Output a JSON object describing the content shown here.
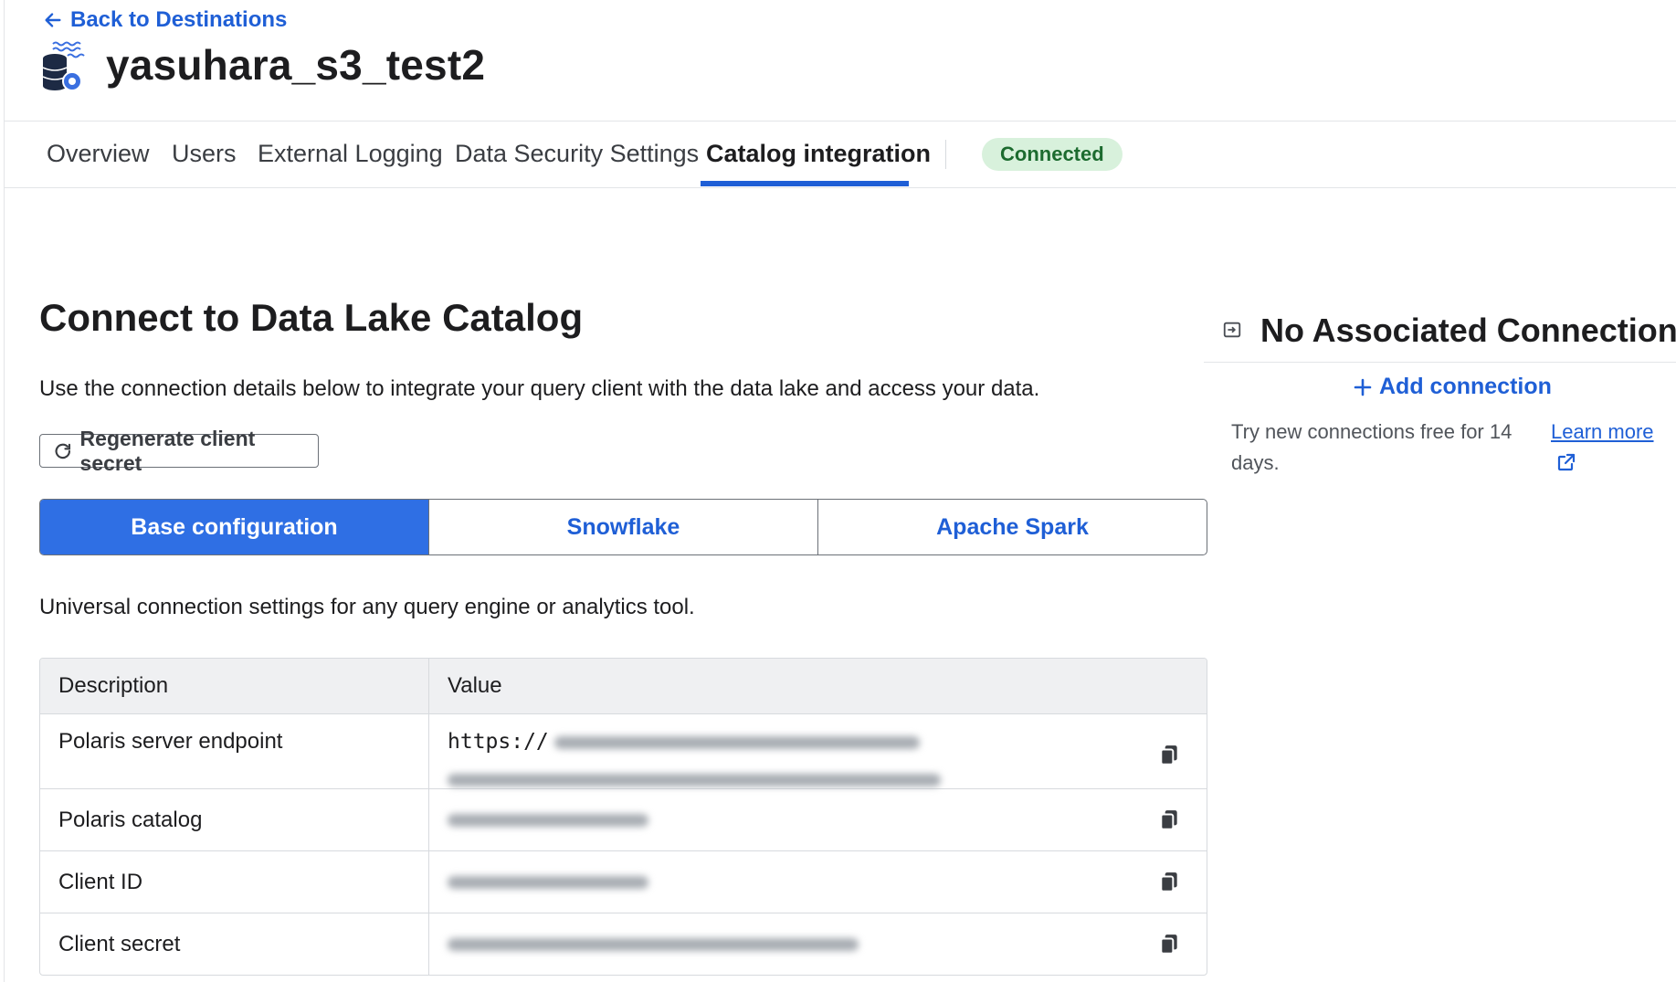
{
  "header": {
    "back_label": "Back to Destinations",
    "title": "yasuhara_s3_test2"
  },
  "tabs": [
    {
      "label": "Overview",
      "active": false
    },
    {
      "label": "Users",
      "active": false
    },
    {
      "label": "External Logging",
      "active": false
    },
    {
      "label": "Data Security Settings",
      "active": false
    },
    {
      "label": "Catalog integration",
      "active": true
    }
  ],
  "status": {
    "label": "Connected",
    "color": "#1c6b2f"
  },
  "main": {
    "title": "Connect to Data Lake Catalog",
    "description": "Use the connection details below to integrate your query client with the data lake and access your data.",
    "regenerate_label": "Regenerate client secret",
    "config_tabs": [
      {
        "label": "Base configuration",
        "active": true
      },
      {
        "label": "Snowflake",
        "active": false
      },
      {
        "label": "Apache Spark",
        "active": false
      }
    ],
    "config_description": "Universal connection settings for any query engine or analytics tool.",
    "table": {
      "headers": [
        "Description",
        "Value"
      ],
      "rows": [
        {
          "description": "Polaris server endpoint",
          "value": "https://"
        },
        {
          "description": "Polaris catalog",
          "value": ""
        },
        {
          "description": "Client ID",
          "value": ""
        },
        {
          "description": "Client secret",
          "value": ""
        }
      ]
    }
  },
  "right_panel": {
    "title": "No Associated Connections",
    "add_label": "Add connection",
    "trial_text": "Try new connections free for 14 days.",
    "learn_more": "Learn more"
  },
  "colors": {
    "accent": "#1f5fd6",
    "segment_active": "#2f6fe4",
    "badge_bg": "#d8f1dc"
  },
  "icons": [
    "arrow-left-icon",
    "destination-database-icon",
    "refresh-icon",
    "copy-icon",
    "link-icon",
    "plus-icon",
    "external-link-icon"
  ]
}
